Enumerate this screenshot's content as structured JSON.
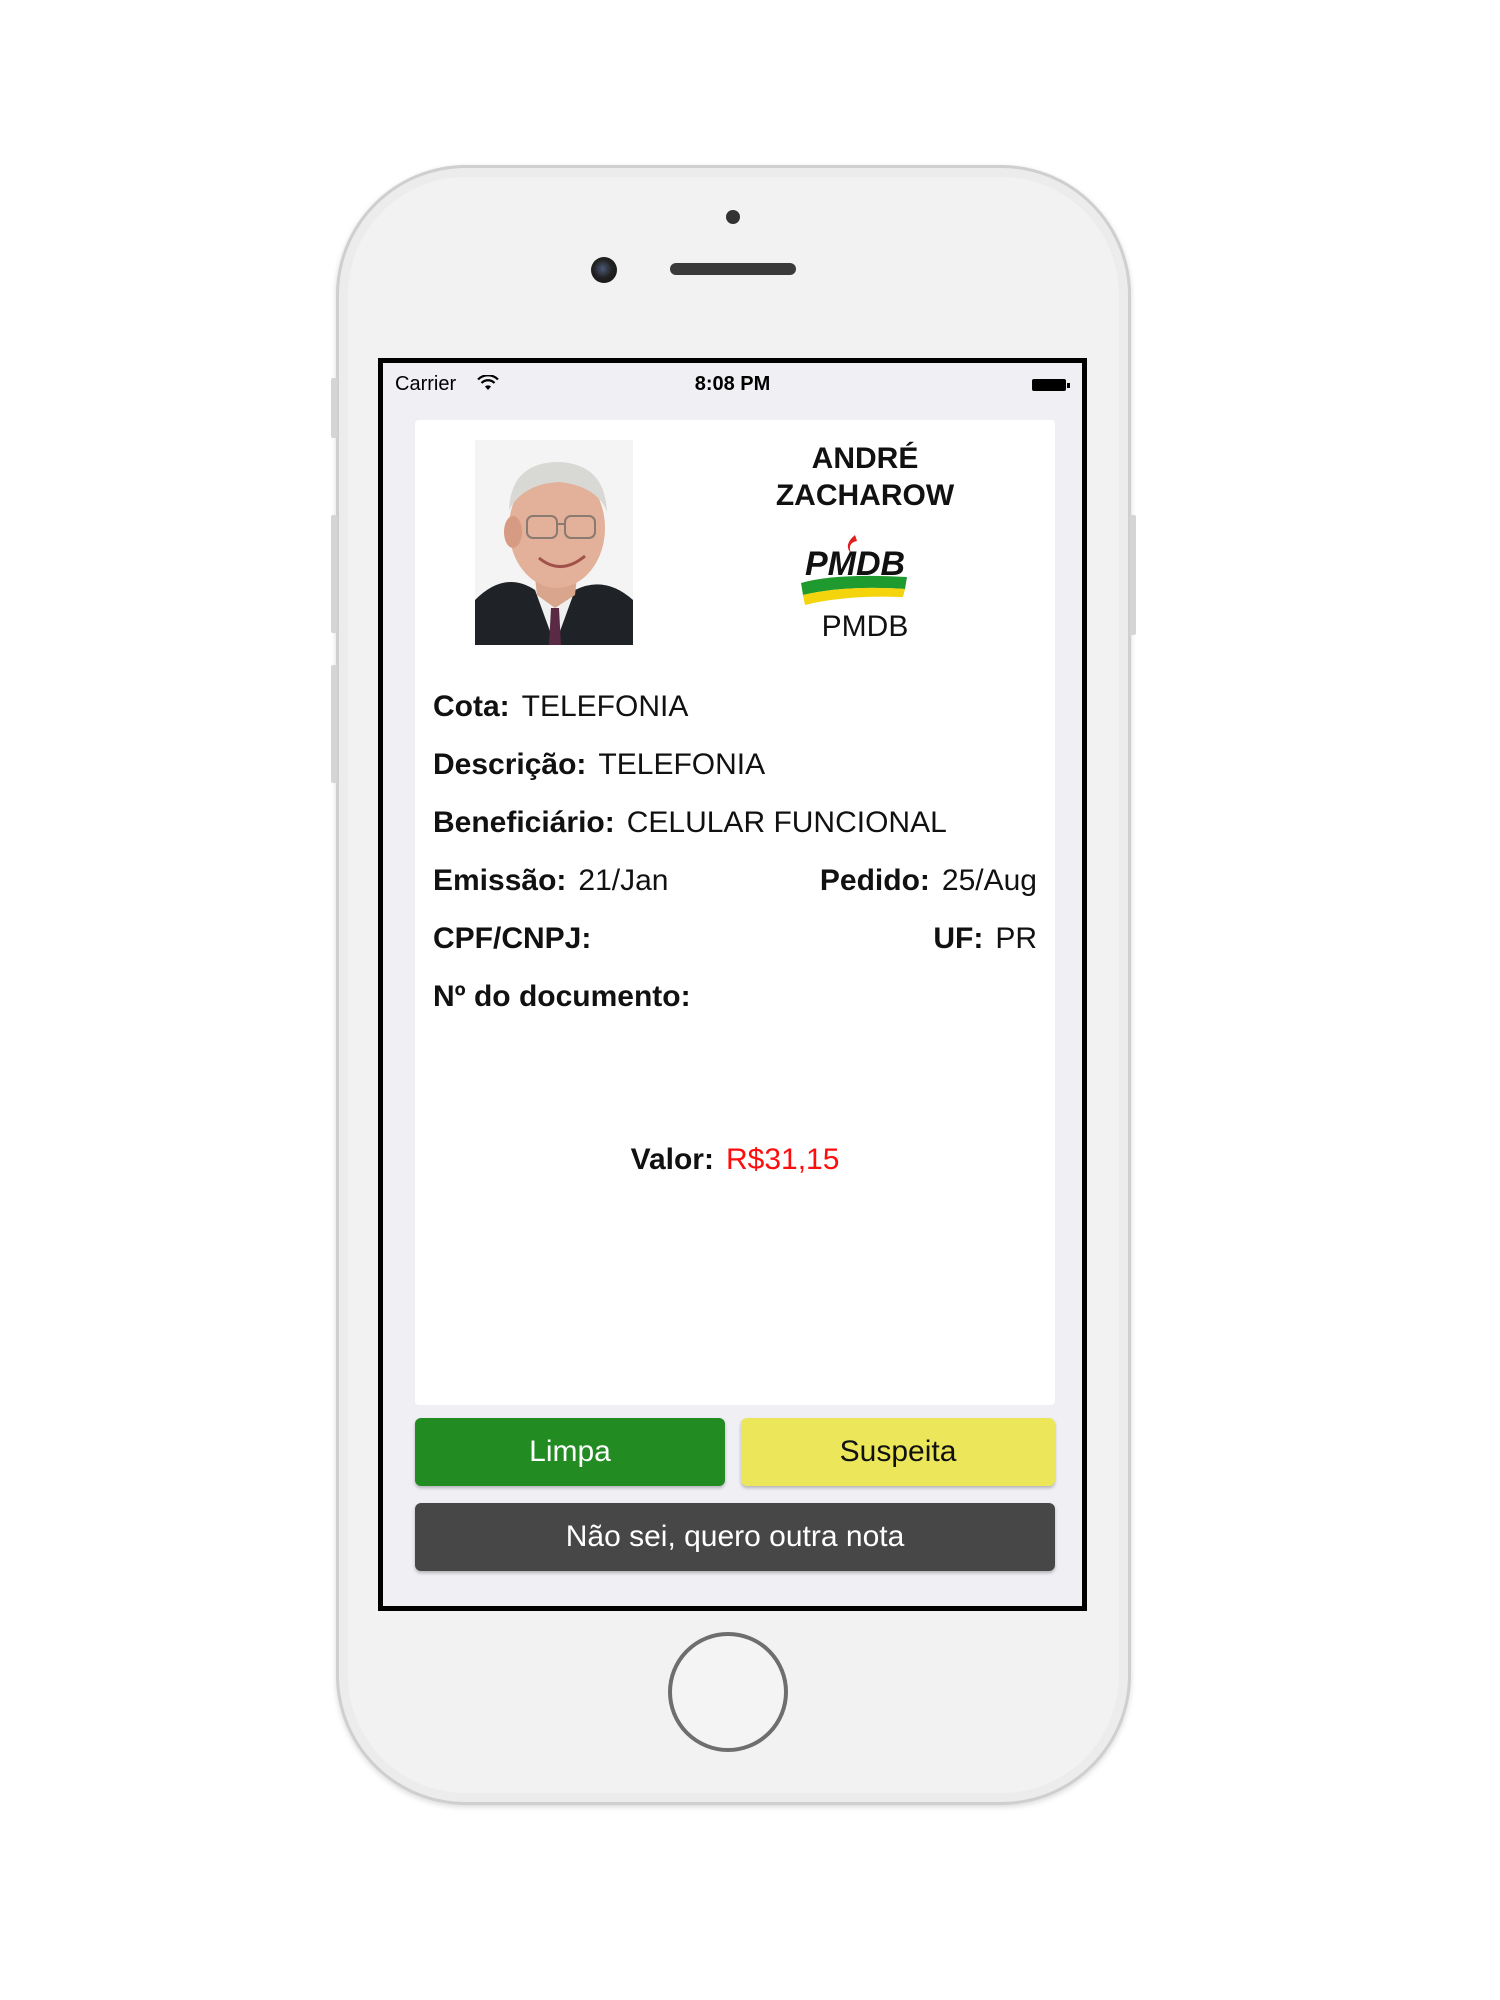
{
  "status_bar": {
    "carrier": "Carrier",
    "time": "8:08 PM"
  },
  "politician": {
    "name_line1": "ANDRÉ",
    "name_line2": "ZACHAROW",
    "party_logo_text": "PMDB",
    "party": "PMDB"
  },
  "details": {
    "cota": {
      "label": "Cota:",
      "value": "TELEFONIA"
    },
    "descricao": {
      "label": "Descrição:",
      "value": "TELEFONIA"
    },
    "beneficiario": {
      "label": "Beneficiário:",
      "value": "CELULAR FUNCIONAL"
    },
    "emissao": {
      "label": "Emissão:",
      "value": "21/Jan"
    },
    "pedido": {
      "label": "Pedido:",
      "value": "25/Aug"
    },
    "cpf_cnpj": {
      "label": "CPF/CNPJ:",
      "value": ""
    },
    "uf": {
      "label": "UF:",
      "value": "PR"
    },
    "documento": {
      "label": "Nº do documento:",
      "value": ""
    },
    "valor": {
      "label": "Valor:",
      "value": "R$31,15"
    }
  },
  "actions": {
    "limpa": "Limpa",
    "suspeita": "Suspeita",
    "outra_nota": "Não sei, quero outra nota"
  },
  "colors": {
    "limpa_bg": "#228b22",
    "suspeita_bg": "#ece75a",
    "outra_bg": "#474747",
    "valor_text": "#ff0d0d"
  }
}
